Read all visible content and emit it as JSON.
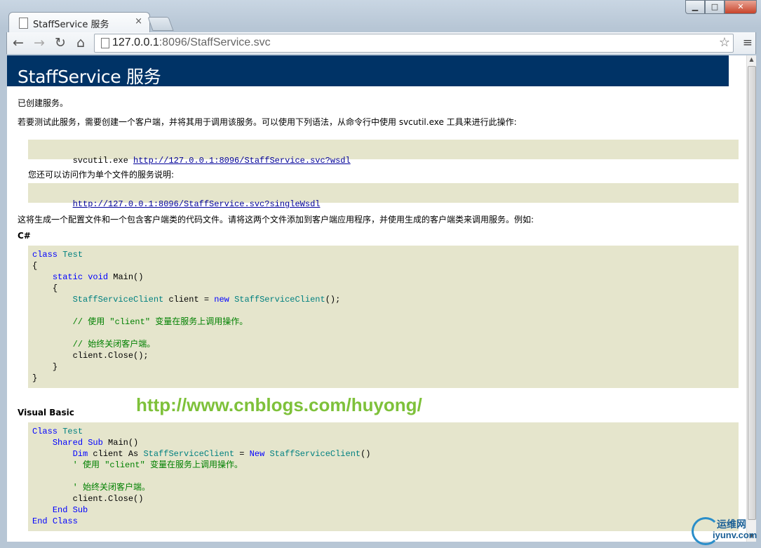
{
  "browser": {
    "tab_title": "StaffService 服务",
    "tab_close": "×",
    "url_host": "127.0.0.1",
    "url_rest": ":8096/StaffService.svc",
    "buttons": {
      "back": "←",
      "forward": "→",
      "reload": "↻",
      "home": "⌂",
      "star": "☆",
      "menu": "≡"
    },
    "window": {
      "minimize": "▁",
      "maximize": "□",
      "close": "✕"
    }
  },
  "page": {
    "heading": "StaffService 服务",
    "created": "已创建服务。",
    "intro": "若要测试此服务，需要创建一个客户端，并将其用于调用该服务。可以使用下列语法，从命令行中使用 svcutil.exe 工具来进行此操作:",
    "svcutil_cmd": "svcutil.exe",
    "wsdl_link": "http://127.0.0.1:8096/StaffService.svc?wsdl",
    "single_file_text": "您还可以访问作为单个文件的服务说明:",
    "single_wsdl_link": "http://127.0.0.1:8096/StaffService.svc?singleWsdl",
    "generate_text": "这将生成一个配置文件和一个包含客户端类的代码文件。请将这两个文件添加到客户端应用程序，并使用生成的客户端类来调用服务。例如:",
    "csharp_label": "C#",
    "vb_label": "Visual Basic",
    "watermark": "http://www.cnblogs.com/huyong/"
  },
  "code": {
    "cs": {
      "class_kw": "class",
      "class_name": "Test",
      "open_brace": "{",
      "close_brace": "}",
      "static_kw": "static",
      "void_kw": "void",
      "main_sig": "Main()",
      "client_type": "StaffServiceClient",
      "client_decl": "client =",
      "new_kw": "new",
      "client_ctor": "StaffServiceClient",
      "ctor_end": "();",
      "comment1": "// 使用 \"client\" 变量在服务上调用操作。",
      "comment2": "// 始终关闭客户端。",
      "close_call": "client.Close();"
    },
    "vb": {
      "class_kw": "Class",
      "class_name": "Test",
      "shared_kw": "Shared",
      "sub_kw": "Sub",
      "main_sig": "Main()",
      "dim_kw": "Dim",
      "client_as": "client As",
      "client_type": "StaffServiceClient",
      "eq": "=",
      "new_kw": "New",
      "client_ctor": "StaffServiceClient",
      "ctor_end": "()",
      "comment1": "' 使用 \"client\" 变量在服务上调用操作。",
      "comment2": "' 始终关闭客户端。",
      "close_call": "client.Close()",
      "end_kw": "End"
    }
  },
  "logo": {
    "cn": "运维网",
    "en": "iyunv.com"
  }
}
